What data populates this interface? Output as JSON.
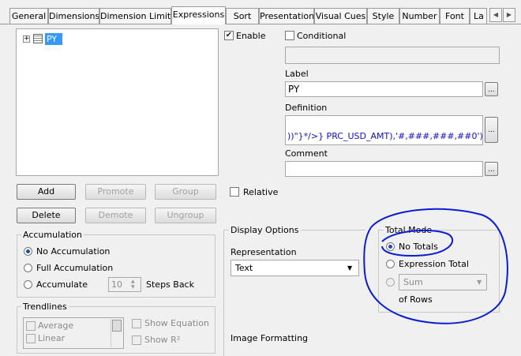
{
  "tabs": [
    "General",
    "Dimensions",
    "Dimension Limits",
    "Expressions",
    "Sort",
    "Presentation",
    "Visual Cues",
    "Style",
    "Number",
    "Font",
    "La"
  ],
  "tree": {
    "item_label": "PY"
  },
  "buttons": {
    "add": "Add",
    "promote": "Promote",
    "group": "Group",
    "delete": "Delete",
    "demote": "Demote",
    "ungroup": "Ungroup"
  },
  "accumulation": {
    "title": "Accumulation",
    "no_accumulation": "No Accumulation",
    "full_accumulation": "Full Accumulation",
    "accumulate": "Accumulate",
    "steps_value": "10",
    "steps_back": "Steps Back"
  },
  "trendlines": {
    "title": "Trendlines",
    "average": "Average",
    "linear": "Linear",
    "show_equation": "Show Equation",
    "show_r2": "Show R²"
  },
  "enable": {
    "label": "Enable",
    "checked": true
  },
  "conditional": {
    "label": "Conditional",
    "checked": false
  },
  "label_section": {
    "title": "Label",
    "value": "PY"
  },
  "definition": {
    "title": "Definition",
    "value": "))\"}*/>} PRC_USD_AMT),'#,###,###,##0')"
  },
  "comment": {
    "title": "Comment",
    "value": ""
  },
  "relative": {
    "label": "Relative",
    "checked": false
  },
  "display_options": {
    "title": "Display Options",
    "representation_label": "Representation",
    "representation_value": "Text",
    "image_formatting": "Image Formatting"
  },
  "total_mode": {
    "title": "Total Mode",
    "no_totals": "No Totals",
    "expression_total": "Expression Total",
    "sum_value": "Sum",
    "of_rows": "of Rows"
  },
  "dots_label": "...",
  "colors": {
    "selection": "#3399ff",
    "annotation": "#0a1bd6"
  }
}
